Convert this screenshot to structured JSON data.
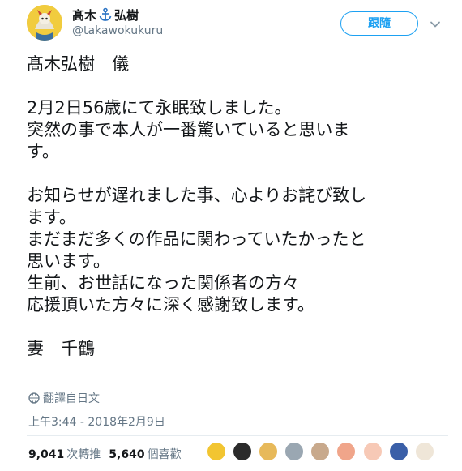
{
  "tweet": {
    "display_name_part1": "髙木",
    "display_name_part2": "弘樹",
    "handle": "@takawokukuru",
    "follow_label": "跟隨",
    "body_lines": [
      "髙木弘樹　儀",
      "",
      "2月2日56歳にて永眠致しました。",
      "突然の事で本人が一番驚いていると思いま",
      "す。",
      "",
      "お知らせが遅れました事、心よりお詫び致し",
      "ます。",
      "まだまだ多くの作品に関わっていたかったと",
      "思います。",
      "生前、お世話になった関係者の方々",
      "応援頂いた方々に深く感謝致します。",
      "",
      "妻　千鶴"
    ],
    "translate_label": "翻譯自日文",
    "timestamp": "上午3:44 - 2018年2月9日",
    "retweet_count": "9,041",
    "retweet_label": "次轉推",
    "like_count": "5,640",
    "like_label": "個喜歡"
  },
  "icons": {
    "anchor": "anchor-icon",
    "caret": "chevron-down-icon",
    "globe": "globe-icon"
  },
  "colors": {
    "accent": "#1da1f2",
    "secondary_text": "#657786",
    "primary_text": "#14171a",
    "divider": "#e6ecf0"
  },
  "likers": [
    {
      "color": "#f2c531"
    },
    {
      "color": "#2b2b2b"
    },
    {
      "color": "#e7b95a"
    },
    {
      "color": "#9aa7b2"
    },
    {
      "color": "#c8a98c"
    },
    {
      "color": "#f0a58a"
    },
    {
      "color": "#f7c9b6"
    },
    {
      "color": "#3a5fa8"
    },
    {
      "color": "#efe6d8"
    }
  ]
}
